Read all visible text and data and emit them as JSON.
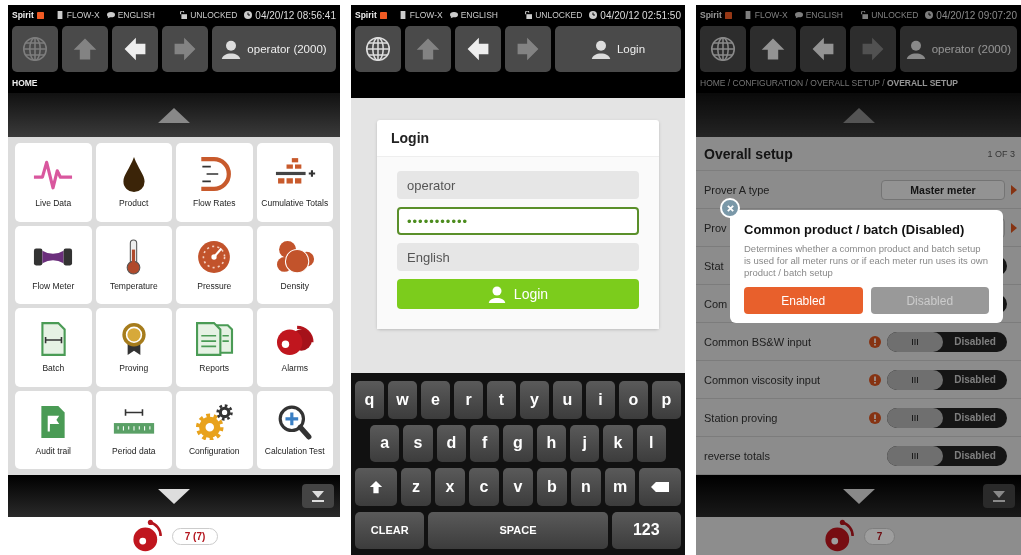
{
  "screens": [
    {
      "kind": "home",
      "status": {
        "brand": "Spirit",
        "device": "FLOW-X",
        "language": "ENGLISH",
        "lock": "UNLOCKED",
        "datetime": "04/20/12 08:56:41"
      },
      "nav": {
        "buttons": [
          {
            "kind": "globe",
            "disabled": true
          },
          {
            "kind": "up",
            "disabled": true
          },
          {
            "kind": "back",
            "disabled": false
          },
          {
            "kind": "forward",
            "disabled": true
          }
        ],
        "user": "operator (2000)"
      },
      "breadcrumb": "HOME",
      "tiles": [
        {
          "label": "Live Data"
        },
        {
          "label": "Product"
        },
        {
          "label": "Flow Rates"
        },
        {
          "label": "Cumulative Totals"
        },
        {
          "label": "Flow Meter"
        },
        {
          "label": "Temperature"
        },
        {
          "label": "Pressure"
        },
        {
          "label": "Density"
        },
        {
          "label": "Batch"
        },
        {
          "label": "Proving"
        },
        {
          "label": "Reports"
        },
        {
          "label": "Alarms"
        },
        {
          "label": "Audit trail"
        },
        {
          "label": "Period data"
        },
        {
          "label": "Configuration"
        },
        {
          "label": "Calculation Test"
        }
      ],
      "alarm_count": "7 (7)"
    },
    {
      "kind": "login",
      "status": {
        "brand": "Spirit",
        "device": "FLOW-X",
        "language": "ENGLISH",
        "lock": "UNLOCKED",
        "datetime": "04/20/12 02:51:50"
      },
      "nav": {
        "buttons": [
          {
            "kind": "globe",
            "disabled": false
          },
          {
            "kind": "up",
            "disabled": true
          },
          {
            "kind": "back",
            "disabled": false
          },
          {
            "kind": "forward",
            "disabled": true
          }
        ],
        "user": "Login"
      },
      "login": {
        "title": "Login",
        "fields": [
          {
            "kind": "text",
            "value": "operator",
            "focused": false
          },
          {
            "kind": "password",
            "value": "•••••••••••",
            "focused": true
          },
          {
            "kind": "select",
            "value": "English",
            "focused": false
          }
        ],
        "button": "Login"
      },
      "keyboard": [
        [
          {
            "kind": "char",
            "label": "q"
          },
          {
            "kind": "char",
            "label": "w"
          },
          {
            "kind": "char",
            "label": "e"
          },
          {
            "kind": "char",
            "label": "r"
          },
          {
            "kind": "char",
            "label": "t"
          },
          {
            "kind": "char",
            "label": "y"
          },
          {
            "kind": "char",
            "label": "u"
          },
          {
            "kind": "char",
            "label": "i"
          },
          {
            "kind": "char",
            "label": "o"
          },
          {
            "kind": "char",
            "label": "p"
          }
        ],
        [
          {
            "kind": "char",
            "label": "a"
          },
          {
            "kind": "char",
            "label": "s"
          },
          {
            "kind": "char",
            "label": "d"
          },
          {
            "kind": "char",
            "label": "f"
          },
          {
            "kind": "char",
            "label": "g"
          },
          {
            "kind": "char",
            "label": "h"
          },
          {
            "kind": "char",
            "label": "j"
          },
          {
            "kind": "char",
            "label": "k"
          },
          {
            "kind": "char",
            "label": "l"
          }
        ],
        [
          {
            "kind": "shift"
          },
          {
            "kind": "char",
            "label": "z"
          },
          {
            "kind": "char",
            "label": "x"
          },
          {
            "kind": "char",
            "label": "c"
          },
          {
            "kind": "char",
            "label": "v"
          },
          {
            "kind": "char",
            "label": "b"
          },
          {
            "kind": "char",
            "label": "n"
          },
          {
            "kind": "char",
            "label": "m"
          },
          {
            "kind": "backspace"
          }
        ],
        [
          {
            "kind": "clear",
            "label": "CLEAR"
          },
          {
            "kind": "space",
            "label": "SPACE"
          },
          {
            "kind": "mode",
            "label": "123"
          }
        ]
      ]
    },
    {
      "kind": "setup",
      "status": {
        "brand": "Spirit",
        "device": "FLOW-X",
        "language": "ENGLISH",
        "lock": "UNLOCKED",
        "datetime": "04/20/12 09:07:20"
      },
      "nav": {
        "buttons": [
          {
            "kind": "globe",
            "disabled": false
          },
          {
            "kind": "up",
            "disabled": false
          },
          {
            "kind": "back",
            "disabled": false
          },
          {
            "kind": "forward",
            "disabled": true
          }
        ],
        "user": "operator (2000)"
      },
      "breadcrumb": "HOME / CONFIGURATION / OVERALL SETUP / **OVERALL SETUP**",
      "setup": {
        "title": "Overall setup",
        "page": "1 OF 3",
        "rows": [
          {
            "label": "Prover A type",
            "kind": "select",
            "value": "Master meter"
          },
          {
            "label": "Prov",
            "kind": "select"
          },
          {
            "label": "Stat",
            "kind": "toggle",
            "on": false
          },
          {
            "label": "Com",
            "kind": "toggle",
            "on": false
          },
          {
            "label": "Common BS&W input",
            "kind": "toggle",
            "handle": "III",
            "value": "Disabled",
            "on": false,
            "info": true
          },
          {
            "label": "Common viscosity input",
            "kind": "toggle",
            "handle": "III",
            "value": "Disabled",
            "on": false,
            "info": true
          },
          {
            "label": "Station proving",
            "kind": "toggle",
            "handle": "III",
            "value": "Disabled",
            "on": false,
            "info": true
          },
          {
            "label": "reverse totals",
            "kind": "toggle",
            "handle": "III",
            "value": "Disabled",
            "on": false
          }
        ]
      },
      "dialog": {
        "title": "Common product / batch (Disabled)",
        "description": "Determines whether a common product and batch setup is used for all meter runs or if each meter run uses its own product / batch setup",
        "options": [
          {
            "label": "Enabled",
            "selected": true
          },
          {
            "label": "Disabled",
            "selected": false
          }
        ]
      },
      "alarm_count": "7"
    }
  ]
}
